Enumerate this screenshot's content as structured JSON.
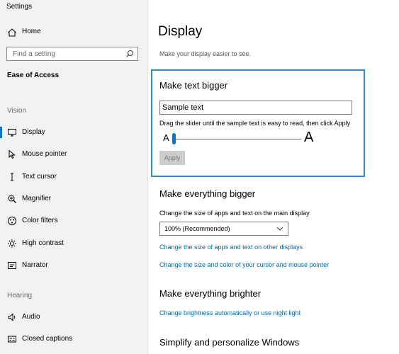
{
  "window": {
    "title": "Settings"
  },
  "sidebar": {
    "home_label": "Home",
    "search_placeholder": "Find a setting",
    "section_title": "Ease of Access",
    "groups": [
      {
        "label": "Vision"
      },
      {
        "label": "Hearing"
      }
    ],
    "vision_items": [
      {
        "label": "Display",
        "icon": "display-icon",
        "active": true
      },
      {
        "label": "Mouse pointer",
        "icon": "mouse-pointer-icon"
      },
      {
        "label": "Text cursor",
        "icon": "text-cursor-icon"
      },
      {
        "label": "Magnifier",
        "icon": "magnifier-icon"
      },
      {
        "label": "Color filters",
        "icon": "color-filters-icon"
      },
      {
        "label": "High contrast",
        "icon": "high-contrast-icon"
      },
      {
        "label": "Narrator",
        "icon": "narrator-icon"
      }
    ],
    "hearing_items": [
      {
        "label": "Audio",
        "icon": "audio-icon"
      },
      {
        "label": "Closed captions",
        "icon": "closed-captions-icon"
      }
    ]
  },
  "main": {
    "title": "Display",
    "subtitle": "Make your display easier to see.",
    "text_bigger": {
      "heading": "Make text bigger",
      "sample_text": "Sample text",
      "hint": "Drag the slider until the sample text is easy to read, then click Apply",
      "small_a": "A",
      "large_a": "A",
      "slider_value_fraction": 0.0,
      "apply_label": "Apply"
    },
    "everything_bigger": {
      "heading": "Make everything bigger",
      "select_label": "Change the size of apps and text on the main display",
      "select_value": "100% (Recommended)",
      "link1": "Change the size of apps and text on other displays",
      "link2": "Change the size and color of your cursor and mouse pointer"
    },
    "everything_brighter": {
      "heading": "Make everything brighter",
      "link": "Change brightness automatically or use night light"
    },
    "simplify": {
      "heading": "Simplify and personalize Windows"
    }
  },
  "colors": {
    "accent": "#0078d7",
    "link": "#0067b8",
    "focus_border": "#2e8ad8"
  }
}
